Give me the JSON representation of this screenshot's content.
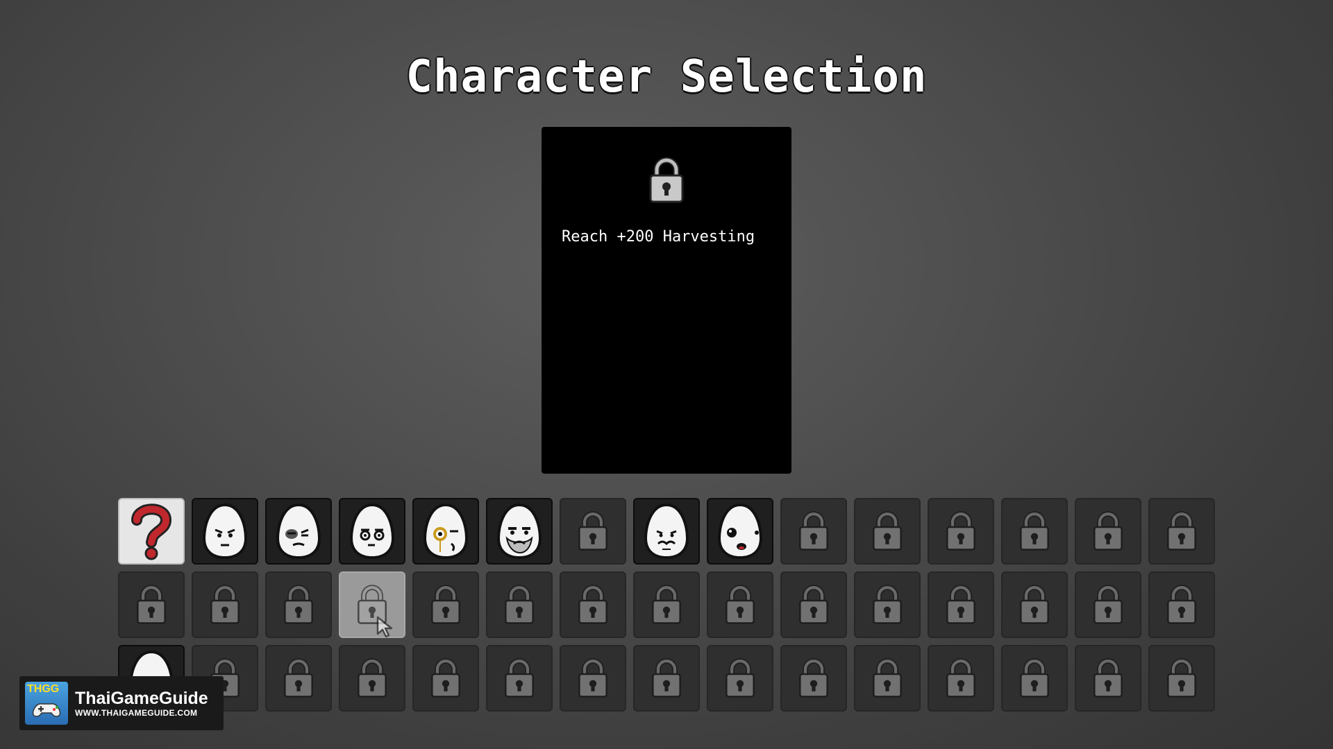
{
  "title": "Character Selection",
  "info_panel": {
    "icon": "lock-icon",
    "requirement": "Reach +200 Harvesting"
  },
  "grid": {
    "columns": 15,
    "slots": [
      {
        "type": "random",
        "icon": "question-mark-icon"
      },
      {
        "type": "char",
        "icon": "frown-egg-face-icon"
      },
      {
        "type": "char",
        "icon": "bruised-egg-face-icon"
      },
      {
        "type": "char",
        "icon": "glasses-egg-face-icon"
      },
      {
        "type": "char",
        "icon": "monocle-egg-face-icon"
      },
      {
        "type": "char",
        "icon": "bearded-egg-face-icon"
      },
      {
        "type": "locked",
        "icon": "lock-icon"
      },
      {
        "type": "char",
        "icon": "mustache-egg-face-icon"
      },
      {
        "type": "char",
        "icon": "dot-eyes-egg-face-icon"
      },
      {
        "type": "locked",
        "icon": "lock-icon"
      },
      {
        "type": "locked",
        "icon": "lock-icon"
      },
      {
        "type": "locked",
        "icon": "lock-icon"
      },
      {
        "type": "locked",
        "icon": "lock-icon"
      },
      {
        "type": "locked",
        "icon": "lock-icon"
      },
      {
        "type": "locked",
        "icon": "lock-icon"
      },
      {
        "type": "locked",
        "icon": "lock-icon"
      },
      {
        "type": "locked",
        "icon": "lock-icon"
      },
      {
        "type": "locked",
        "icon": "lock-icon"
      },
      {
        "type": "hover",
        "icon": "lock-icon"
      },
      {
        "type": "locked",
        "icon": "lock-icon"
      },
      {
        "type": "locked",
        "icon": "lock-icon"
      },
      {
        "type": "locked",
        "icon": "lock-icon"
      },
      {
        "type": "locked",
        "icon": "lock-icon"
      },
      {
        "type": "locked",
        "icon": "lock-icon"
      },
      {
        "type": "locked",
        "icon": "lock-icon"
      },
      {
        "type": "locked",
        "icon": "lock-icon"
      },
      {
        "type": "locked",
        "icon": "lock-icon"
      },
      {
        "type": "locked",
        "icon": "lock-icon"
      },
      {
        "type": "locked",
        "icon": "lock-icon"
      },
      {
        "type": "locked",
        "icon": "lock-icon"
      },
      {
        "type": "char",
        "icon": "masked-egg-face-icon"
      },
      {
        "type": "locked",
        "icon": "lock-icon"
      },
      {
        "type": "locked",
        "icon": "lock-icon"
      },
      {
        "type": "locked",
        "icon": "lock-icon"
      },
      {
        "type": "locked",
        "icon": "lock-icon"
      },
      {
        "type": "locked",
        "icon": "lock-icon"
      },
      {
        "type": "locked",
        "icon": "lock-icon"
      },
      {
        "type": "locked",
        "icon": "lock-icon"
      },
      {
        "type": "locked",
        "icon": "lock-icon"
      },
      {
        "type": "locked",
        "icon": "lock-icon"
      },
      {
        "type": "locked",
        "icon": "lock-icon"
      },
      {
        "type": "locked",
        "icon": "lock-icon"
      },
      {
        "type": "locked",
        "icon": "lock-icon"
      },
      {
        "type": "locked",
        "icon": "lock-icon"
      },
      {
        "type": "locked",
        "icon": "lock-icon"
      }
    ]
  },
  "watermark": {
    "logo_text": "THGG",
    "name": "ThaiGameGuide",
    "url": "WWW.THAIGAMEGUIDE.COM"
  }
}
